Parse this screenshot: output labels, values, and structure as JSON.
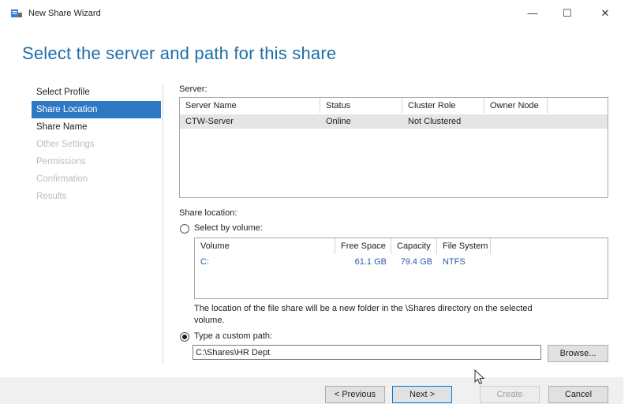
{
  "window": {
    "title": "New Share Wizard",
    "controls": {
      "minimize": "—",
      "maximize": "☐",
      "close": "✕"
    }
  },
  "heading": "Select the server and path for this share",
  "nav": {
    "items": [
      {
        "label": "Select Profile",
        "state": "normal"
      },
      {
        "label": "Share Location",
        "state": "active"
      },
      {
        "label": "Share Name",
        "state": "normal"
      },
      {
        "label": "Other Settings",
        "state": "disabled"
      },
      {
        "label": "Permissions",
        "state": "disabled"
      },
      {
        "label": "Confirmation",
        "state": "disabled"
      },
      {
        "label": "Results",
        "state": "disabled"
      }
    ]
  },
  "server": {
    "label": "Server:",
    "columns": [
      "Server Name",
      "Status",
      "Cluster Role",
      "Owner Node"
    ],
    "rows": [
      {
        "server_name": "CTW-Server",
        "status": "Online",
        "cluster_role": "Not Clustered",
        "owner_node": ""
      }
    ]
  },
  "share_location": {
    "label": "Share location:",
    "select_by_volume_label": "Select by volume:",
    "select_by_volume_checked": false,
    "volume_columns": [
      "Volume",
      "Free Space",
      "Capacity",
      "File System"
    ],
    "volumes": [
      {
        "volume": "C:",
        "free_space": "61.1 GB",
        "capacity": "79.4 GB",
        "file_system": "NTFS"
      }
    ],
    "info_line1": "The location of the file share will be a new folder in the \\Shares directory on the selected",
    "info_line2": "volume.",
    "custom_path_label": "Type a custom path:",
    "custom_path_checked": true,
    "custom_path_value": "C:\\Shares\\HR Dept",
    "browse_label": "Browse..."
  },
  "footer": {
    "previous_label": "< Previous",
    "next_label": "Next >",
    "create_label": "Create",
    "cancel_label": "Cancel"
  },
  "colors": {
    "accent": "#2f78c4",
    "heading": "#1e6ea7",
    "volume_text": "#2a5ca8",
    "selected_row": "#e5e5e5"
  }
}
